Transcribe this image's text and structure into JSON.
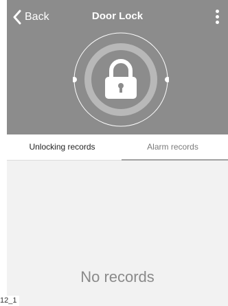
{
  "nav": {
    "back_label": "Back",
    "title": "Door Lock"
  },
  "icons": {
    "back": "chevron-left-icon",
    "menu": "more-vertical-icon",
    "lock": "padlock-icon"
  },
  "tabs": [
    {
      "label": "Unlocking records",
      "active": true
    },
    {
      "label": "Alarm records",
      "active": false
    }
  ],
  "content": {
    "empty_message": "No records"
  },
  "footer": {
    "label": "12_1"
  },
  "colors": {
    "header_bg": "#8c8c8c",
    "page_bg": "#f2f2f2",
    "ring": "#c4c4c4",
    "white": "#ffffff"
  }
}
